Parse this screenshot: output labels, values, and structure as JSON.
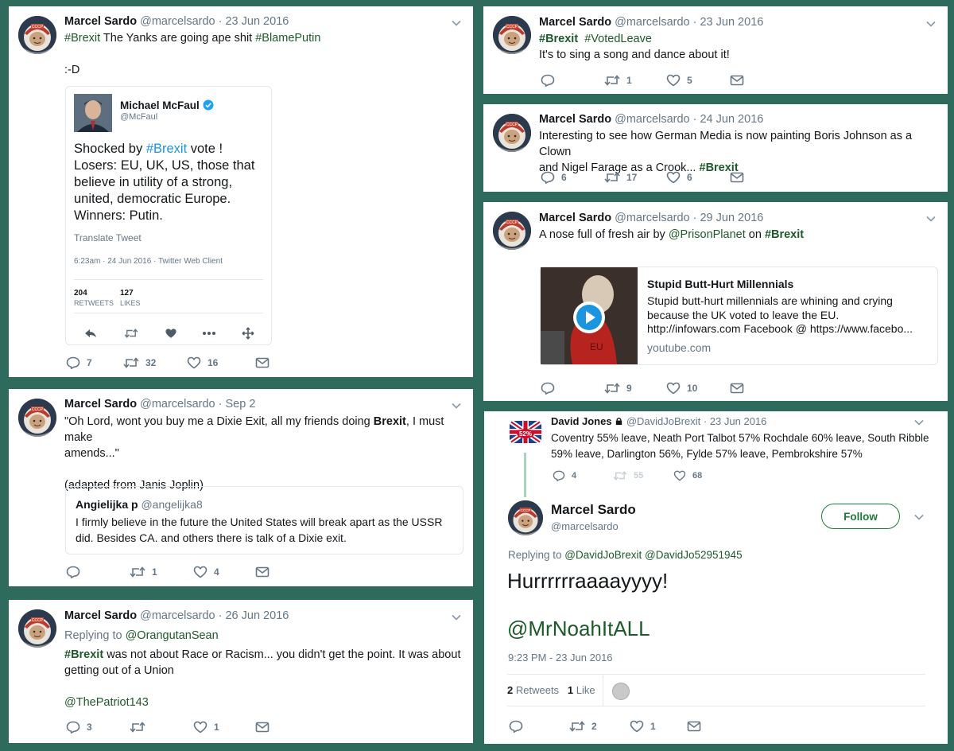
{
  "t1": {
    "name": "Marcel Sardo",
    "handle": "@marcelsardo",
    "date": "· 23 Jun 2016",
    "tag1": "#Brexit",
    "text1": " The Yanks are going ape shit ",
    "tag2": "#BlamePutin",
    "smile": ":-D",
    "embed": {
      "name": "Michael McFaul",
      "handle": "@McFaul",
      "t1": "Shocked by ",
      "tag": "#Brexit",
      "t2": " vote !",
      "l2": "Losers: EU, UK, US, those that",
      "l3": "believe in utility of a strong,",
      "l4": "united, democratic Europe.",
      "l5": "Winners: Putin.",
      "translate": "Translate Tweet",
      "meta": "6:23am · 24 Jun 2016 · Twitter Web Client",
      "rt_count": "204",
      "rt_label": "RETWEETS",
      "like_count": "127",
      "like_label": "LIKES"
    },
    "replies": "7",
    "retweets": "32",
    "likes": "16"
  },
  "t2": {
    "name": "Marcel Sardo",
    "handle": "@marcelsardo",
    "date": "· 23 Jun 2016",
    "tag1": "#Brexit",
    "tag2": "#VotedLeave",
    "text": "It's to sing a song and dance about it!",
    "replies": "",
    "retweets": "1",
    "likes": "5"
  },
  "t3": {
    "name": "Marcel Sardo",
    "handle": "@marcelsardo",
    "date": "· 24 Jun 2016",
    "line1": "Interesting to see how German Media is now painting Boris Johnson as a Clown",
    "line2": "and Nigel Farage as a Crook... ",
    "tag": "#Brexit",
    "replies": "6",
    "retweets": "17",
    "likes": "6"
  },
  "t4": {
    "name": "Marcel Sardo",
    "handle": "@marcelsardo",
    "date": "· 29 Jun 2016",
    "t1": "A nose full of fresh air by ",
    "mention": "@PrisonPlanet",
    "t2": " on ",
    "tag": "#Brexit",
    "card": {
      "title": "Stupid Butt-Hurt Millennials",
      "d1": "Stupid butt-hurt millennials are whining and crying",
      "d2": "because the UK voted to leave the EU.",
      "d3": "http://infowars.com Facebook @ https://www.facebo...",
      "domain": "youtube.com",
      "thumb_text": "EU"
    },
    "replies": "",
    "retweets": "9",
    "likes": "10"
  },
  "t5": {
    "name": "Marcel Sardo",
    "handle": "@marcelsardo",
    "date": "· Sep 2",
    "l1a": "\"Oh Lord, wont you buy me a Dixie Exit, all my friends doing ",
    "l1b": "Brexit",
    "l1c": ", I must make",
    "l2": "amends...\"",
    "l3": "(adapted from Janis Joplin)",
    "quote": {
      "name": "Angielijka p",
      "handle": "@angelijka8",
      "l1": "I firmly believe in the future the United States will break apart as the USSR",
      "l2": "did. Besides CA. and others there is talk of a Dixie exit."
    },
    "replies": "",
    "retweets": "1",
    "likes": "4"
  },
  "t6": {
    "name": "Marcel Sardo",
    "handle": "@marcelsardo",
    "date": "· 26 Jun 2016",
    "reply_prefix": "Replying to ",
    "reply_to": "@OrangutanSean",
    "tag": "#Brexit",
    "l1": " was not about Race or Racism... you didn't get the point. It was about",
    "l2": "getting out of a Union",
    "mention": "@ThePatriot143",
    "replies": "3",
    "retweets": "",
    "likes": "1"
  },
  "t7": {
    "parent": {
      "name": "David Jones",
      "handle": "@DavidJoBrexit",
      "date": "· 23 Jun 2016",
      "badge": "52%",
      "l1": "Coventry 55% leave, Neath Port Talbot 57% Rochdale 60% leave, South Ribble",
      "l2": "59% leave, Darlington 56%, Fylde 57% leave, Pembrokshire 57%",
      "replies": "4",
      "retweets": "55",
      "likes": "68"
    },
    "name": "Marcel Sardo",
    "handle": "@marcelsardo",
    "follow": "Follow",
    "reply_prefix": "Replying to ",
    "reply_to": "@DavidJoBrexit @DavidJo52951945",
    "main": "Hurrrrrraaaayyyy!",
    "mention": "@MrNoahItALL",
    "time": "9:23 PM - 23 Jun 2016",
    "rt_count": "2",
    "rt_label": "Retweets",
    "like_count": "1",
    "like_label": "Like",
    "replies": "",
    "retweets": "2",
    "likes": "1"
  },
  "colors": {
    "background": "#2f6b5c",
    "hashtag": "#1d5a2a",
    "muted": "#657786",
    "follow": "#1d7a3a"
  }
}
